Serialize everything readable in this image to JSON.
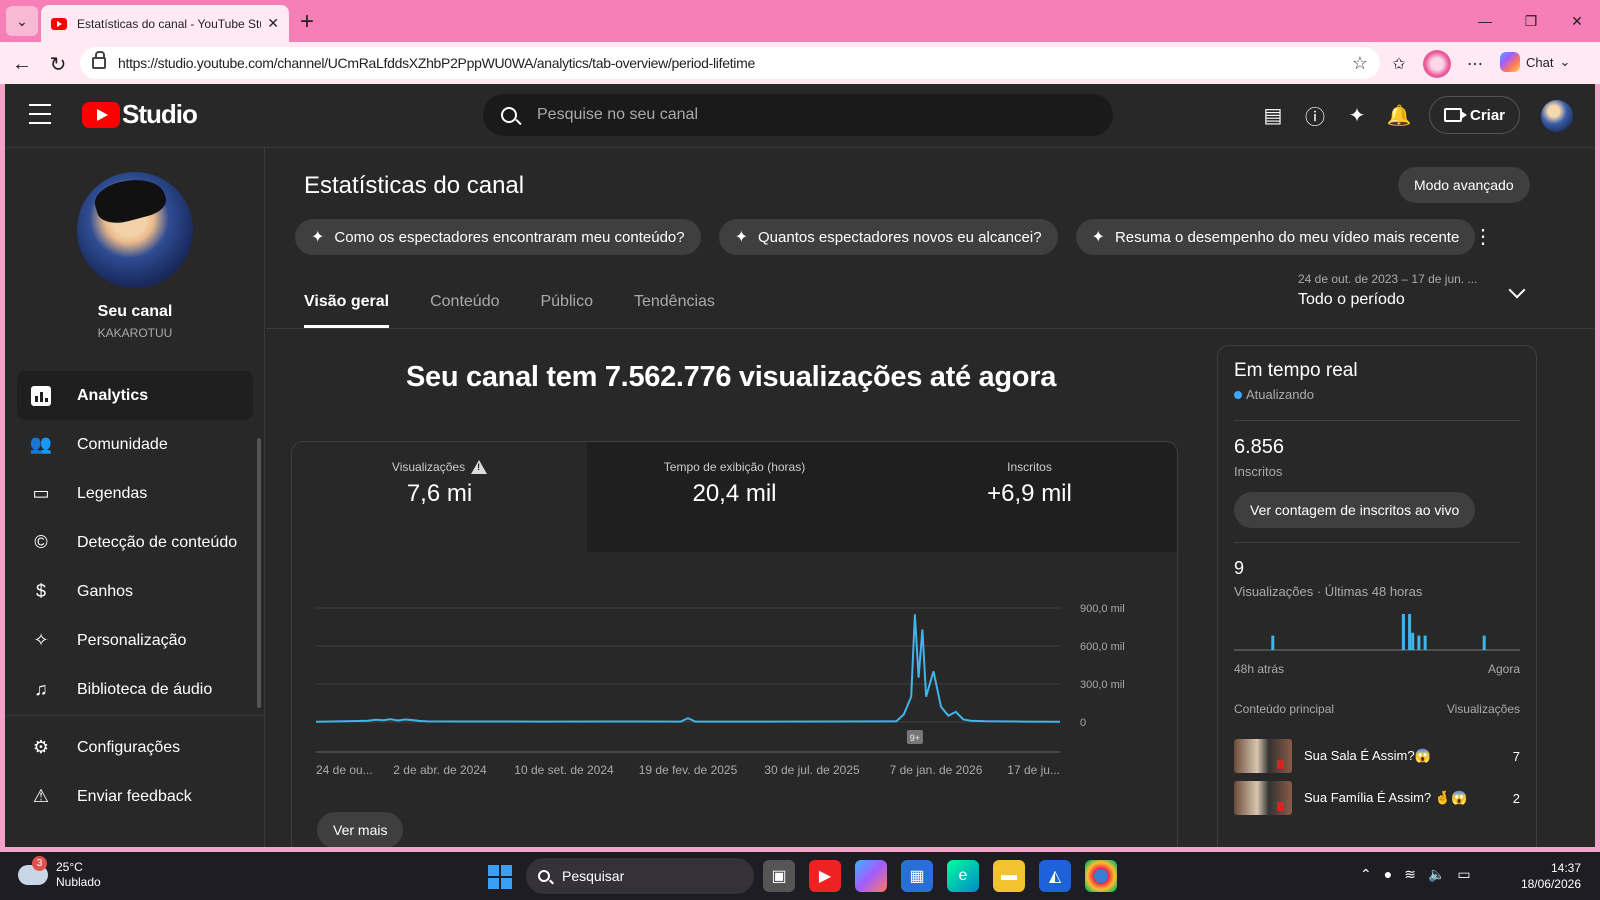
{
  "browser": {
    "tab_title": "Estatísticas do canal - YouTube Studio",
    "url": "https://studio.youtube.com/channel/UCmRaLfddsXZhbP2PppWU0WA/analytics/tab-overview/period-lifetime",
    "chat_label": "Chat"
  },
  "header": {
    "logo_text": "Studio",
    "search_placeholder": "Pesquise no seu canal",
    "create_label": "Criar"
  },
  "sidebar": {
    "channel_name": "Seu canal",
    "channel_handle": "KAKAROTUU",
    "items": [
      {
        "label": "Analytics",
        "icon": "analytics-icon",
        "active": true
      },
      {
        "label": "Comunidade",
        "icon": "community-icon"
      },
      {
        "label": "Legendas",
        "icon": "subtitles-icon"
      },
      {
        "label": "Detecção de conteúdo",
        "icon": "copyright-icon"
      },
      {
        "label": "Ganhos",
        "icon": "dollar-icon"
      },
      {
        "label": "Personalização",
        "icon": "magic-wand-icon"
      },
      {
        "label": "Biblioteca de áudio",
        "icon": "audio-library-icon"
      }
    ],
    "bottom_items": [
      {
        "label": "Configurações",
        "icon": "gear-icon"
      },
      {
        "label": "Enviar feedback",
        "icon": "feedback-icon"
      }
    ]
  },
  "main": {
    "title": "Estatísticas do canal",
    "advanced_mode": "Modo avançado",
    "suggestions": [
      "Como os espectadores encontraram meu conteúdo?",
      "Quantos espectadores novos eu alcancei?",
      "Resuma o desempenho do meu vídeo mais recente"
    ],
    "period_range": "24 de out. de 2023 – 17 de jun. ...",
    "period_label": "Todo o período",
    "tabs": [
      "Visão geral",
      "Conteúdo",
      "Público",
      "Tendências"
    ],
    "headline": "Seu canal tem 7.562.776 visualizações até agora",
    "metrics": [
      {
        "label": "Visualizações",
        "value": "7,6 mi"
      },
      {
        "label": "Tempo de exibição (horas)",
        "value": "20,4 mil"
      },
      {
        "label": "Inscritos",
        "value": "+6,9 mil"
      }
    ],
    "marker_label": "9+",
    "see_more": "Ver mais"
  },
  "chart_data": {
    "type": "line",
    "series": [
      {
        "x": [
          0.0,
          0.04,
          0.07,
          0.08,
          0.09,
          0.1,
          0.11,
          0.12,
          0.13,
          0.14,
          0.15,
          0.2,
          0.3,
          0.4,
          0.49,
          0.5,
          0.51,
          0.6,
          0.7,
          0.78,
          0.79,
          0.8,
          0.805,
          0.81,
          0.815,
          0.82,
          0.83,
          0.84,
          0.85,
          0.86,
          0.87,
          0.88,
          0.9,
          0.95,
          1.0
        ],
        "y": [
          2000,
          6000,
          10000,
          18000,
          14000,
          22000,
          12000,
          20000,
          15000,
          8000,
          5000,
          4000,
          3000,
          4000,
          3000,
          30000,
          3000,
          3000,
          4000,
          5000,
          60000,
          200000,
          850000,
          350000,
          730000,
          200000,
          400000,
          120000,
          50000,
          80000,
          20000,
          10000,
          6000,
          3000,
          2000
        ]
      }
    ],
    "x_tick_labels": [
      "24 de ou...",
      "2 de abr. de 2024",
      "10 de set. de 2024",
      "19 de fev. de 2025",
      "30 de jul. de 2025",
      "7 de jan. de 2026",
      "17 de ju..."
    ],
    "y_tick_labels": [
      "0",
      "300,0 mil",
      "600,0 mil",
      "900,0 mil"
    ],
    "ylim": [
      0,
      900000
    ],
    "color": "#41b4e8"
  },
  "realtime": {
    "title": "Em tempo real",
    "status": "Atualizando",
    "subscribers": "6.856",
    "subscribers_label": "Inscritos",
    "live_button": "Ver contagem de inscritos ao vivo",
    "views": "9",
    "views_label": "Visualizações · Últimas 48 horas",
    "bars": [
      0,
      0,
      0,
      0,
      0,
      0,
      0,
      0,
      0,
      0,
      0,
      0,
      1,
      0,
      0,
      0,
      0,
      0,
      0,
      0,
      0,
      0,
      0,
      0,
      0,
      0,
      0,
      0,
      0,
      0,
      0,
      0,
      0,
      0,
      0,
      0,
      0,
      0,
      0,
      0,
      0,
      0,
      0,
      0,
      0,
      0,
      0,
      0,
      0,
      0,
      0,
      0,
      0,
      0,
      2.5,
      0,
      2.5,
      1.2,
      0,
      1,
      0,
      1,
      0,
      0,
      0,
      0,
      0,
      0,
      0,
      0,
      0,
      0,
      0,
      0,
      0,
      0,
      0,
      0,
      0,
      0,
      1,
      0,
      0,
      0,
      0,
      0,
      0,
      0,
      0,
      0,
      0,
      0
    ],
    "left_label": "48h atrás",
    "right_label": "Agora",
    "top_content_header": "Conteúdo principal",
    "top_views_header": "Visualizações",
    "top_items": [
      {
        "title": "Sua Sala É Assim?😱",
        "views": "7"
      },
      {
        "title": "Sua Família É Assim? 🤞😱",
        "views": "2"
      }
    ]
  },
  "taskbar": {
    "weather_temp": "25°C",
    "weather_desc": "Nublado",
    "weather_badge": "3",
    "search_label": "Pesquisar",
    "time": "14:37",
    "date": "18/06/2026"
  }
}
